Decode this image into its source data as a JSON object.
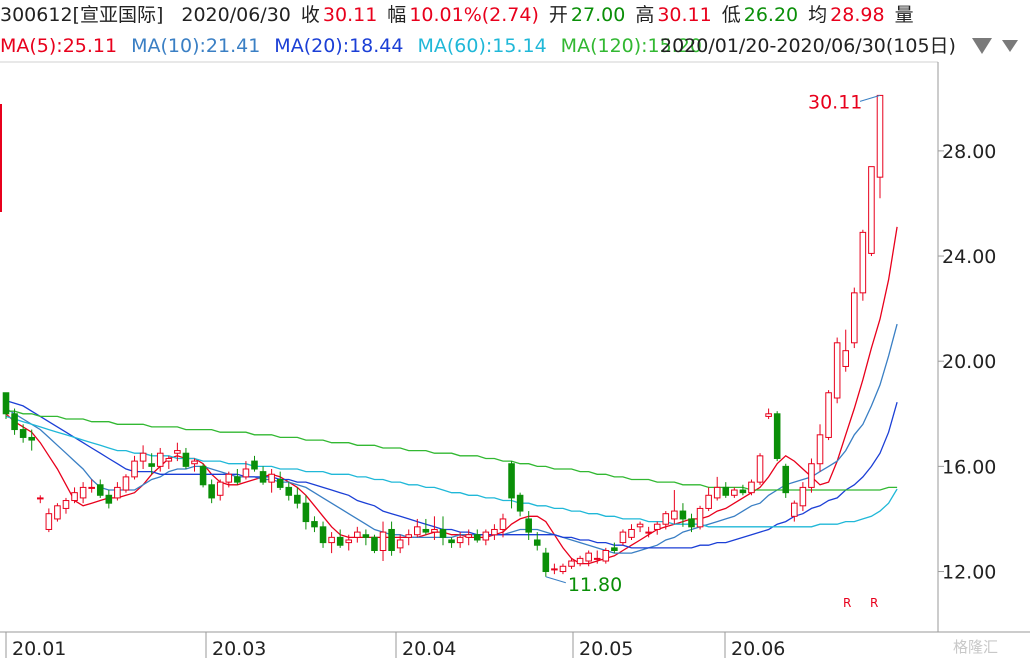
{
  "header": {
    "row1": [
      {
        "text": "300612[宣亚国际]",
        "color": "#222222"
      },
      {
        "text": "2020/06/30",
        "color": "#222222"
      },
      {
        "text": "收",
        "color": "#222222"
      },
      {
        "text": "30.11",
        "color": "#e8001c"
      },
      {
        "text": "幅",
        "color": "#222222"
      },
      {
        "text": "10.01%(2.74)",
        "color": "#e8001c"
      },
      {
        "text": "开",
        "color": "#222222"
      },
      {
        "text": "27.00",
        "color": "#0a8f08"
      },
      {
        "text": "高",
        "color": "#222222"
      },
      {
        "text": "30.11",
        "color": "#e8001c"
      },
      {
        "text": "低",
        "color": "#222222"
      },
      {
        "text": "26.20",
        "color": "#0a8f08"
      },
      {
        "text": "均",
        "color": "#222222"
      },
      {
        "text": "28.98",
        "color": "#e8001c"
      },
      {
        "text": "量",
        "color": "#222222"
      }
    ],
    "row2": [
      {
        "text": "MA(5):25.11",
        "color": "#e8001c"
      },
      {
        "text": "MA(10):21.41",
        "color": "#3a7fc4"
      },
      {
        "text": "MA(20):18.44",
        "color": "#1b3fd6"
      },
      {
        "text": "MA(60):15.14",
        "color": "#20b8d8"
      },
      {
        "text": "MA(120):15.20",
        "color": "#32b832"
      }
    ],
    "range": "2020/01/20-2020/06/30(105日)"
  },
  "watermark": "格隆汇",
  "chart_data": {
    "type": "candlestick",
    "x_ticks": [
      "20.01",
      "20.03",
      "20.04",
      "20.05",
      "20.06"
    ],
    "y_ticks": [
      "12.00",
      "16.00",
      "20.00",
      "24.00",
      "28.00"
    ],
    "ylim": [
      9.7,
      31.0
    ],
    "high_label": "30.11",
    "low_label": "11.80",
    "markers": [
      "R",
      "R"
    ],
    "ohlc": [
      [
        18.8,
        18.8,
        17.8,
        18.0
      ],
      [
        18.0,
        18.2,
        17.2,
        17.4
      ],
      [
        17.4,
        17.6,
        16.9,
        17.1
      ],
      [
        17.1,
        17.4,
        16.6,
        17.0
      ],
      [
        14.8,
        14.9,
        14.6,
        14.8
      ],
      [
        13.6,
        14.4,
        13.5,
        14.2
      ],
      [
        14.0,
        14.6,
        13.9,
        14.5
      ],
      [
        14.4,
        14.8,
        14.2,
        14.7
      ],
      [
        14.7,
        15.2,
        14.6,
        15.0
      ],
      [
        14.8,
        15.4,
        14.6,
        15.2
      ],
      [
        15.2,
        15.5,
        15.0,
        15.2
      ],
      [
        15.3,
        15.5,
        14.8,
        14.9
      ],
      [
        14.9,
        15.1,
        14.4,
        14.6
      ],
      [
        14.8,
        15.4,
        14.7,
        15.2
      ],
      [
        15.1,
        15.7,
        15.0,
        15.6
      ],
      [
        15.6,
        16.4,
        15.5,
        16.2
      ],
      [
        16.2,
        16.8,
        15.9,
        16.5
      ],
      [
        16.1,
        16.5,
        15.7,
        16.0
      ],
      [
        16.0,
        16.7,
        15.8,
        16.5
      ],
      [
        16.2,
        16.4,
        15.9,
        16.3
      ],
      [
        16.5,
        16.9,
        16.2,
        16.6
      ],
      [
        16.5,
        16.7,
        15.9,
        16.0
      ],
      [
        16.1,
        16.3,
        15.8,
        16.2
      ],
      [
        16.0,
        16.1,
        15.2,
        15.3
      ],
      [
        15.3,
        15.5,
        14.6,
        14.8
      ],
      [
        14.9,
        15.5,
        14.7,
        15.4
      ],
      [
        15.4,
        15.8,
        15.2,
        15.7
      ],
      [
        15.6,
        15.9,
        15.3,
        15.4
      ],
      [
        15.6,
        16.2,
        15.5,
        15.9
      ],
      [
        16.2,
        16.4,
        15.8,
        15.9
      ],
      [
        15.8,
        16.0,
        15.3,
        15.4
      ],
      [
        15.4,
        15.9,
        15.0,
        15.7
      ],
      [
        15.5,
        15.8,
        15.1,
        15.2
      ],
      [
        15.2,
        15.4,
        14.7,
        14.9
      ],
      [
        14.9,
        15.2,
        14.4,
        14.6
      ],
      [
        14.6,
        14.9,
        13.6,
        13.9
      ],
      [
        13.9,
        14.1,
        13.5,
        13.7
      ],
      [
        13.7,
        13.9,
        12.9,
        13.1
      ],
      [
        13.1,
        13.5,
        12.7,
        13.3
      ],
      [
        13.3,
        13.6,
        12.9,
        13.0
      ],
      [
        13.1,
        13.4,
        12.8,
        13.2
      ],
      [
        13.3,
        13.7,
        13.1,
        13.5
      ],
      [
        13.4,
        13.6,
        13.0,
        13.3
      ],
      [
        13.3,
        13.4,
        12.7,
        12.8
      ],
      [
        12.8,
        13.9,
        12.4,
        13.5
      ],
      [
        13.6,
        13.9,
        12.6,
        12.8
      ],
      [
        12.9,
        13.4,
        12.7,
        13.2
      ],
      [
        13.3,
        13.6,
        13.0,
        13.4
      ],
      [
        13.4,
        14.0,
        13.3,
        13.7
      ],
      [
        13.6,
        14.0,
        13.4,
        13.5
      ],
      [
        13.5,
        14.1,
        13.2,
        13.6
      ],
      [
        13.6,
        14.1,
        13.0,
        13.3
      ],
      [
        13.2,
        13.3,
        12.9,
        13.1
      ],
      [
        13.1,
        13.5,
        12.9,
        13.3
      ],
      [
        13.3,
        13.6,
        13.0,
        13.4
      ],
      [
        13.4,
        13.6,
        13.1,
        13.2
      ],
      [
        13.2,
        13.6,
        13.0,
        13.5
      ],
      [
        13.4,
        13.8,
        13.2,
        13.6
      ],
      [
        13.6,
        14.2,
        13.3,
        14.0
      ],
      [
        16.1,
        16.2,
        14.4,
        14.8
      ],
      [
        14.9,
        15.0,
        14.1,
        14.3
      ],
      [
        14.0,
        14.3,
        13.2,
        13.5
      ],
      [
        13.2,
        13.5,
        12.8,
        13.0
      ],
      [
        12.7,
        12.9,
        11.8,
        12.0
      ],
      [
        12.1,
        12.3,
        11.9,
        12.1
      ],
      [
        12.0,
        12.3,
        11.9,
        12.2
      ],
      [
        12.2,
        12.5,
        12.1,
        12.4
      ],
      [
        12.3,
        12.6,
        12.2,
        12.5
      ],
      [
        12.4,
        12.8,
        12.2,
        12.7
      ],
      [
        12.5,
        12.8,
        12.3,
        12.5
      ],
      [
        12.4,
        12.9,
        12.3,
        12.8
      ],
      [
        12.9,
        13.1,
        12.7,
        12.8
      ],
      [
        13.1,
        13.6,
        13.0,
        13.5
      ],
      [
        13.3,
        13.8,
        13.2,
        13.6
      ],
      [
        13.7,
        13.9,
        13.5,
        13.8
      ],
      [
        13.5,
        13.7,
        13.3,
        13.5
      ],
      [
        13.6,
        13.9,
        13.4,
        13.8
      ],
      [
        13.8,
        14.3,
        13.6,
        14.2
      ],
      [
        14.0,
        15.1,
        13.8,
        14.3
      ],
      [
        14.3,
        14.6,
        13.7,
        14.0
      ],
      [
        14.0,
        14.2,
        13.5,
        13.7
      ],
      [
        13.7,
        14.5,
        13.6,
        14.4
      ],
      [
        14.4,
        15.2,
        14.3,
        14.9
      ],
      [
        14.8,
        15.6,
        14.7,
        15.2
      ],
      [
        15.2,
        15.4,
        14.8,
        14.9
      ],
      [
        14.9,
        15.2,
        14.8,
        15.1
      ],
      [
        15.1,
        15.3,
        14.9,
        15.0
      ],
      [
        15.0,
        15.5,
        14.9,
        15.4
      ],
      [
        15.4,
        16.5,
        15.3,
        16.4
      ],
      [
        17.9,
        18.2,
        17.8,
        18.0
      ],
      [
        18.0,
        18.1,
        16.2,
        16.3
      ],
      [
        16.0,
        16.1,
        14.8,
        15.0
      ],
      [
        14.1,
        14.7,
        13.9,
        14.6
      ],
      [
        14.5,
        15.4,
        14.3,
        15.2
      ],
      [
        15.2,
        16.3,
        15.0,
        16.1
      ],
      [
        16.1,
        17.6,
        15.8,
        17.2
      ],
      [
        17.1,
        18.9,
        17.0,
        18.8
      ],
      [
        18.6,
        20.9,
        18.4,
        20.7
      ],
      [
        19.8,
        21.2,
        19.6,
        20.4
      ],
      [
        20.7,
        22.8,
        20.5,
        22.6
      ],
      [
        22.6,
        25.0,
        22.3,
        24.9
      ],
      [
        24.1,
        27.4,
        24.0,
        27.4
      ],
      [
        27.0,
        30.11,
        26.2,
        30.11
      ]
    ],
    "ma": [
      {
        "name": "MA(5)",
        "color": "#e8001c",
        "values": [
          18.0,
          17.7,
          17.5,
          17.3,
          16.9,
          16.4,
          15.9,
          15.3,
          14.7,
          14.5,
          14.6,
          14.7,
          14.8,
          14.8,
          14.9,
          15.0,
          15.3,
          15.7,
          16.0,
          16.3,
          16.4,
          16.3,
          16.3,
          16.1,
          15.7,
          15.4,
          15.3,
          15.3,
          15.4,
          15.5,
          15.6,
          15.7,
          15.6,
          15.4,
          15.2,
          14.9,
          14.5,
          14.1,
          13.7,
          13.4,
          13.3,
          13.3,
          13.3,
          13.3,
          13.3,
          13.3,
          13.3,
          13.3,
          13.3,
          13.4,
          13.5,
          13.5,
          13.4,
          13.4,
          13.3,
          13.3,
          13.3,
          13.4,
          13.5,
          13.8,
          14.0,
          14.1,
          14.1,
          13.9,
          13.4,
          12.9,
          12.5,
          12.3,
          12.3,
          12.4,
          12.5,
          12.6,
          12.8,
          13.0,
          13.2,
          13.4,
          13.6,
          13.7,
          13.8,
          13.9,
          14.0,
          14.0,
          14.1,
          14.3,
          14.4,
          14.6,
          14.8,
          15.0,
          15.2,
          15.6,
          16.1,
          16.4,
          16.2,
          15.9,
          15.6,
          15.3,
          15.4,
          16.2,
          17.2,
          18.2,
          19.3,
          20.5,
          21.6,
          23.1,
          25.11
        ]
      },
      {
        "name": "MA(10)",
        "color": "#3a7fc4",
        "values": [
          18.2,
          18.0,
          17.8,
          17.6,
          17.4,
          17.1,
          16.8,
          16.5,
          16.2,
          15.9,
          15.5,
          15.2,
          15.1,
          15.1,
          15.1,
          15.1,
          15.3,
          15.5,
          15.6,
          15.8,
          15.9,
          15.9,
          16.0,
          16.0,
          15.9,
          15.8,
          15.7,
          15.6,
          15.6,
          15.6,
          15.5,
          15.5,
          15.4,
          15.4,
          15.3,
          15.2,
          15.0,
          14.8,
          14.6,
          14.4,
          14.2,
          14.0,
          13.8,
          13.6,
          13.5,
          13.4,
          13.4,
          13.3,
          13.3,
          13.3,
          13.3,
          13.3,
          13.3,
          13.4,
          13.4,
          13.4,
          13.4,
          13.4,
          13.4,
          13.5,
          13.6,
          13.6,
          13.6,
          13.5,
          13.4,
          13.3,
          13.2,
          13.1,
          13.0,
          12.9,
          12.8,
          12.7,
          12.7,
          12.7,
          12.8,
          12.9,
          13.0,
          13.2,
          13.3,
          13.5,
          13.6,
          13.7,
          13.8,
          13.9,
          14.0,
          14.1,
          14.3,
          14.5,
          14.6,
          14.9,
          15.1,
          15.3,
          15.4,
          15.5,
          15.6,
          15.8,
          16.0,
          16.2,
          16.6,
          17.2,
          17.6,
          18.3,
          19.1,
          20.2,
          21.41
        ]
      },
      {
        "name": "MA(20)",
        "color": "#1b3fd6",
        "values": [
          18.5,
          18.4,
          18.3,
          18.1,
          17.9,
          17.7,
          17.5,
          17.3,
          17.1,
          16.9,
          16.7,
          16.5,
          16.3,
          16.1,
          15.9,
          15.8,
          15.8,
          15.8,
          15.7,
          15.7,
          15.7,
          15.7,
          15.7,
          15.7,
          15.7,
          15.7,
          15.7,
          15.7,
          15.6,
          15.6,
          15.6,
          15.6,
          15.5,
          15.5,
          15.4,
          15.4,
          15.3,
          15.2,
          15.1,
          15.0,
          14.9,
          14.7,
          14.6,
          14.5,
          14.3,
          14.2,
          14.1,
          14.0,
          13.9,
          13.8,
          13.7,
          13.6,
          13.6,
          13.5,
          13.5,
          13.4,
          13.4,
          13.4,
          13.4,
          13.4,
          13.4,
          13.4,
          13.4,
          13.4,
          13.4,
          13.3,
          13.3,
          13.2,
          13.2,
          13.1,
          13.1,
          13.0,
          13.0,
          12.9,
          12.9,
          12.9,
          12.9,
          12.9,
          12.9,
          12.9,
          12.9,
          13.0,
          13.0,
          13.1,
          13.1,
          13.2,
          13.3,
          13.4,
          13.5,
          13.6,
          13.8,
          13.9,
          14.1,
          14.2,
          14.4,
          14.5,
          14.7,
          14.8,
          15.1,
          15.3,
          15.6,
          16.0,
          16.5,
          17.3,
          18.44
        ]
      },
      {
        "name": "MA(60)",
        "color": "#20b8d8",
        "values": [
          17.9,
          17.8,
          17.7,
          17.6,
          17.5,
          17.4,
          17.3,
          17.2,
          17.1,
          17.0,
          16.9,
          16.8,
          16.7,
          16.6,
          16.6,
          16.5,
          16.5,
          16.4,
          16.4,
          16.4,
          16.3,
          16.3,
          16.3,
          16.2,
          16.2,
          16.2,
          16.1,
          16.1,
          16.1,
          16.0,
          16.0,
          16.0,
          15.9,
          15.9,
          15.9,
          15.8,
          15.8,
          15.8,
          15.7,
          15.7,
          15.7,
          15.6,
          15.6,
          15.5,
          15.5,
          15.4,
          15.4,
          15.3,
          15.3,
          15.2,
          15.2,
          15.1,
          15.0,
          15.0,
          14.9,
          14.9,
          14.8,
          14.8,
          14.7,
          14.7,
          14.6,
          14.6,
          14.5,
          14.5,
          14.4,
          14.4,
          14.3,
          14.3,
          14.2,
          14.2,
          14.1,
          14.1,
          14.0,
          14.0,
          14.0,
          13.9,
          13.9,
          13.9,
          13.8,
          13.8,
          13.8,
          13.8,
          13.7,
          13.7,
          13.7,
          13.7,
          13.7,
          13.7,
          13.7,
          13.7,
          13.7,
          13.7,
          13.7,
          13.7,
          13.7,
          13.8,
          13.8,
          13.8,
          13.9,
          13.9,
          14.0,
          14.1,
          14.3,
          14.6,
          15.14
        ]
      },
      {
        "name": "MA(120)",
        "color": "#32b832",
        "values": [
          18.1,
          18.1,
          18.0,
          18.0,
          17.9,
          17.9,
          17.9,
          17.8,
          17.8,
          17.8,
          17.7,
          17.7,
          17.7,
          17.6,
          17.6,
          17.6,
          17.6,
          17.5,
          17.5,
          17.5,
          17.5,
          17.4,
          17.4,
          17.4,
          17.4,
          17.3,
          17.3,
          17.3,
          17.3,
          17.2,
          17.2,
          17.2,
          17.1,
          17.1,
          17.1,
          17.0,
          17.0,
          17.0,
          16.9,
          16.9,
          16.9,
          16.8,
          16.8,
          16.8,
          16.7,
          16.7,
          16.7,
          16.6,
          16.6,
          16.6,
          16.5,
          16.5,
          16.5,
          16.4,
          16.4,
          16.4,
          16.3,
          16.3,
          16.2,
          16.2,
          16.1,
          16.1,
          16.0,
          16.0,
          15.9,
          15.9,
          15.9,
          15.8,
          15.8,
          15.7,
          15.7,
          15.6,
          15.6,
          15.5,
          15.5,
          15.5,
          15.4,
          15.4,
          15.4,
          15.3,
          15.3,
          15.3,
          15.2,
          15.2,
          15.2,
          15.2,
          15.2,
          15.1,
          15.1,
          15.1,
          15.1,
          15.1,
          15.1,
          15.1,
          15.1,
          15.1,
          15.1,
          15.1,
          15.1,
          15.1,
          15.1,
          15.1,
          15.1,
          15.2,
          15.2
        ]
      }
    ]
  }
}
